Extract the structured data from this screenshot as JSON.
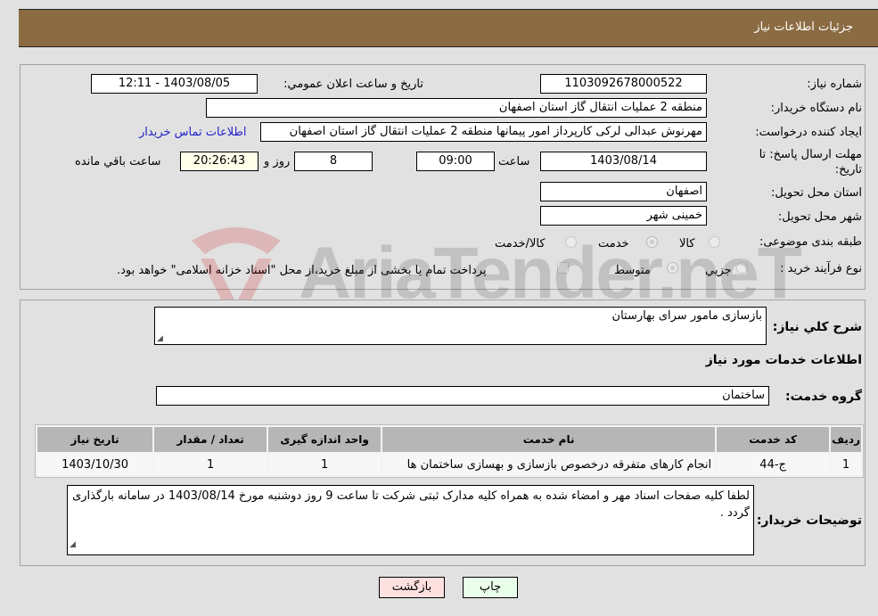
{
  "header": {
    "title": "جزئیات اطلاعات نیاز"
  },
  "form": {
    "need_number": {
      "label": "شماره نیاز:",
      "value": "1103092678000522"
    },
    "announce_datetime": {
      "label": "تاریخ و ساعت اعلان عمومي:",
      "value": "1403/08/05 - 12:11"
    },
    "buyer_org": {
      "label": "نام دستگاه خریدار:",
      "value": "منطقه 2 عملیات انتقال گاز استان اصفهان"
    },
    "requester": {
      "label": "ایجاد کننده درخواست:",
      "value": "مهرنوش عبدالی لرکی کارپرداز امور پیمانها منطقه 2 عملیات انتقال گاز استان اصفهان",
      "contact_link": "اطلاعات تماس خریدار"
    },
    "deadline": {
      "label": "مهلت ارسال پاسخ: تا تاریخ:",
      "date": "1403/08/14",
      "time_label": "ساعت",
      "time": "09:00",
      "days": "8",
      "days_label": "روز و",
      "remaining": "20:26:43",
      "remaining_label": "ساعت باقي مانده"
    },
    "province": {
      "label": "استان محل تحویل:",
      "value": "اصفهان"
    },
    "city": {
      "label": "شهر محل تحویل:",
      "value": "خمینی شهر"
    },
    "category": {
      "label": "طبقه بندی موضوعی:",
      "options": [
        "کالا",
        "خدمت",
        "کالا/خدمت"
      ],
      "selected": "خدمت"
    },
    "purchase_process": {
      "label": "نوع فرآیند خرید :",
      "options": [
        "جزیي",
        "متوسط"
      ],
      "selected": "متوسط",
      "treasury_note": "پرداخت تمام یا بخشی از مبلغ خرید،از محل \"اسناد خزانه اسلامی\" خواهد بود."
    }
  },
  "description": {
    "label": "شرح كلي نياز:",
    "value": "بازسازی مامور سرای بهارستان"
  },
  "services_section": {
    "title": "اطلاعات خدمات مورد نیاز",
    "group_label": "گروه خدمت:",
    "group_value": "ساختمان",
    "table": {
      "headers": [
        "ردیف",
        "کد خدمت",
        "نام خدمت",
        "واحد اندازه گیری",
        "تعداد / مقدار",
        "تاریخ نیاز"
      ],
      "rows": [
        [
          "1",
          "ج-44",
          "انجام کارهای متفرقه درخصوص بازسازی و بهسازی ساختمان ها",
          "1",
          "1",
          "1403/10/30"
        ]
      ]
    }
  },
  "buyer_notes": {
    "label": "توضیحات خریدار:",
    "value": "لطفا کلیه صفحات اسناد مهر و امضاء شده به همراه کلیه مدارک ثبتی شرکت تا ساعت 9 روز دوشنبه مورخ 1403/08/14 در سامانه بارگذاری گردد ."
  },
  "buttons": {
    "print": "چاپ",
    "back": "بازگشت"
  },
  "watermark": {
    "text": "AriaTender.neT"
  },
  "colors": {
    "header_bg": "#8b6b42",
    "link": "#2222cc",
    "back_btn_bg": "#ffe0e0",
    "print_btn_bg": "#eaffea",
    "remaining_bg": "#ffffea"
  }
}
